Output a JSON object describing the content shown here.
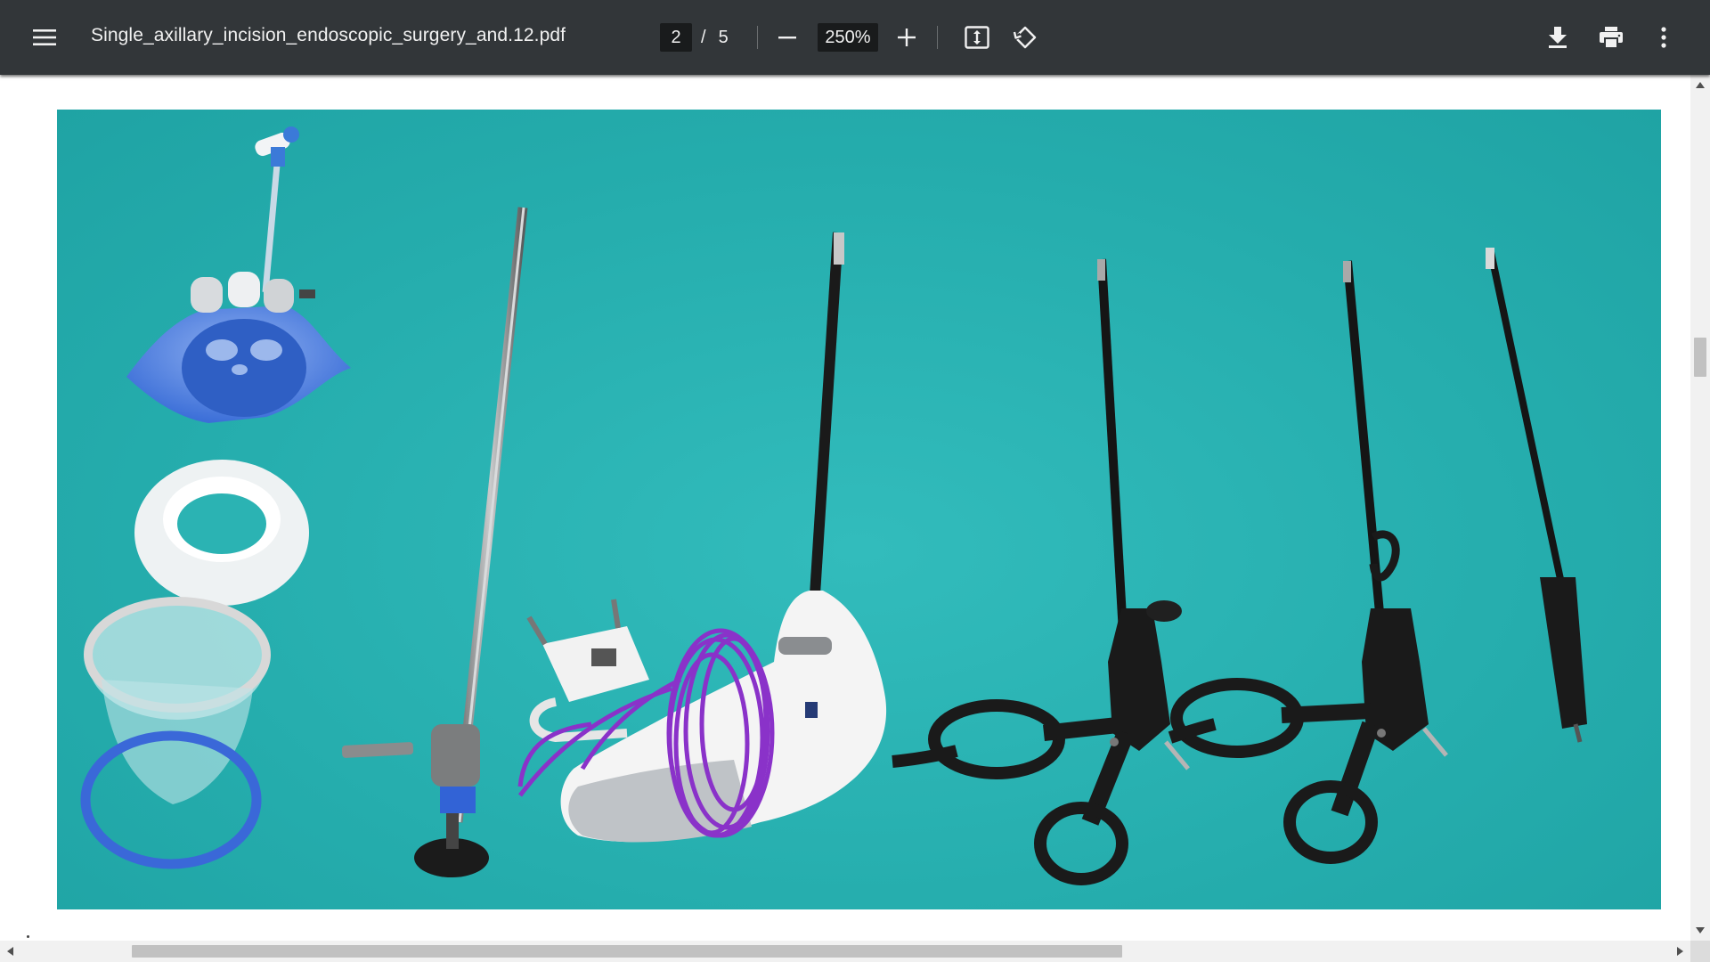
{
  "toolbar": {
    "title": "Single_axillary_incision_endoscopic_surgery_and.12.pdf",
    "page_current": "2",
    "page_separator": "/",
    "page_total": "5",
    "zoom": "250%",
    "icons": {
      "menu": "menu-icon",
      "zoom_out": "minus-icon",
      "zoom_in": "plus-icon",
      "fit": "fit-to-page-icon",
      "rotate": "rotate-icon",
      "download": "download-icon",
      "print": "print-icon",
      "more": "more-vertical-icon"
    }
  },
  "colors": {
    "toolbar_bg": "#323639",
    "toolbar_text": "#f1f1f1",
    "input_bg": "#191b1c",
    "page_bg_teal": "#2bb3b3",
    "scrollbar_track": "#f1f1f1",
    "scrollbar_thumb": "#c1c1c1"
  },
  "scroll": {
    "vertical_position_fraction": 0.31,
    "vertical_thumb_fraction": 0.047,
    "horizontal_position_fraction": 0.17,
    "horizontal_thumb_fraction": 0.6
  }
}
